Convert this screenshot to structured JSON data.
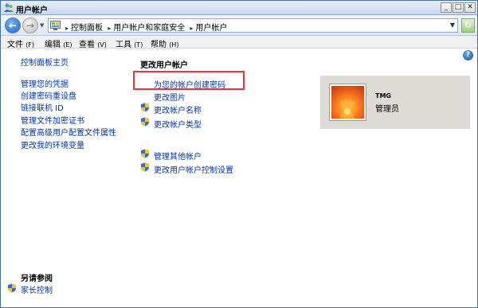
{
  "window": {
    "title": "用户帐户",
    "minimize": "_",
    "maximize": "□",
    "close": "✕"
  },
  "address": {
    "crumbs": [
      "控制面板",
      "用户帐户和家庭安全",
      "用户帐户"
    ]
  },
  "menu": [
    {
      "label": "文件",
      "accel": "(F)"
    },
    {
      "label": "编辑",
      "accel": "(E)"
    },
    {
      "label": "查看",
      "accel": "(V)"
    },
    {
      "label": "工具",
      "accel": "(T)"
    },
    {
      "label": "帮助",
      "accel": "(H)"
    }
  ],
  "sidebar": {
    "home": "控制面板主页",
    "links": [
      "管理您的凭据",
      "创建密码重设盘",
      "链接联机 ID",
      "管理文件加密证书",
      "配置高级用户配置文件属性",
      "更改我的环境变量"
    ],
    "see_also_heading": "另请参阅",
    "see_also": "家长控制"
  },
  "main": {
    "title": "更改用户帐户",
    "tasks": [
      {
        "label": "为您的帐户创建密码",
        "shield": false
      },
      {
        "label": "更改图片",
        "shield": false
      },
      {
        "label": "更改帐户名称",
        "shield": true
      },
      {
        "label": "更改帐户类型",
        "shield": true
      }
    ],
    "other_tasks": [
      {
        "label": "管理其他帐户",
        "shield": true
      },
      {
        "label": "更改用户帐户控制设置",
        "shield": true
      }
    ]
  },
  "account": {
    "name": "TMG",
    "role": "管理员"
  },
  "icons": {
    "help": "?",
    "back": "←",
    "forward": "→",
    "refresh": "↻"
  },
  "colors": {
    "link": "#0033aa",
    "highlight": "#e53a3a",
    "card": "#dcdbd6"
  }
}
